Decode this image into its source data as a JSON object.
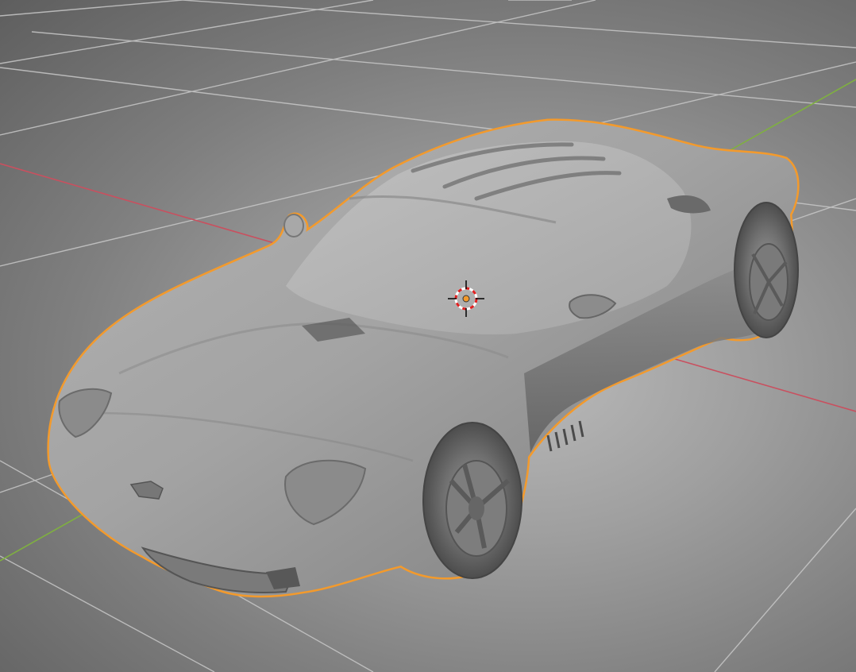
{
  "viewport": {
    "mode": "3d-viewport",
    "shading": "solid"
  },
  "colors": {
    "background_center": "#b9b9b9",
    "background_edge": "#5e5e5e",
    "grid_line": "#c8c8c8",
    "x_axis": "#c9505f",
    "y_axis": "#7fb040",
    "selection_outline": "#f39a2c",
    "mesh_base": "#9a9a9a",
    "mesh_highlight": "#c6c6c6",
    "mesh_shadow": "#5c5c5c",
    "cursor_ring_red": "#e02020",
    "cursor_ring_white": "#ffffff",
    "origin_dot": "#f39a2c"
  },
  "scene": {
    "selected_object": {
      "kind": "car-mesh",
      "selected": true
    },
    "icons": [
      "3d-cursor-icon",
      "object-origin-icon"
    ]
  }
}
